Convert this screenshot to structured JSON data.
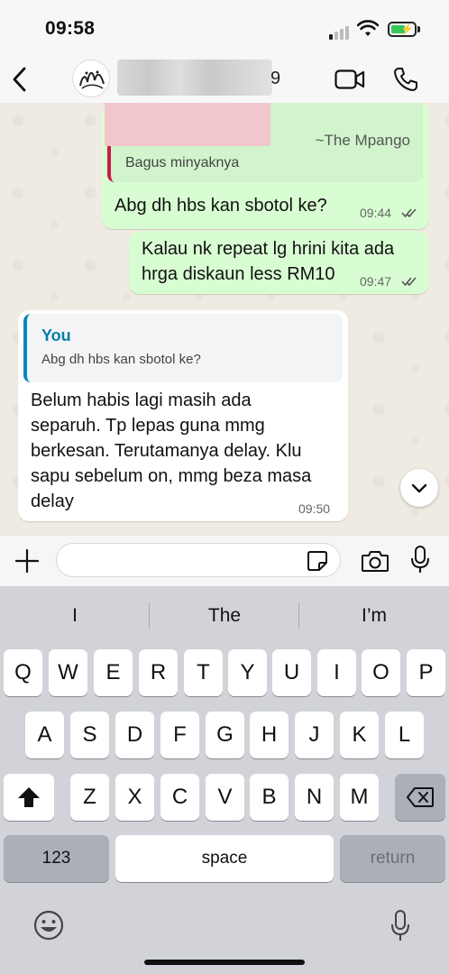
{
  "status_bar": {
    "time": "09:58"
  },
  "header": {
    "contact_name_suffix": "9"
  },
  "messages": {
    "quoted_out": {
      "sender": "~The Mpango",
      "text": "Bagus minyaknya"
    },
    "out1": {
      "text": "Abg dh hbs kan sbotol ke?",
      "time": "09:44"
    },
    "out2": {
      "line1": "Kalau nk repeat lg hrini kita ada",
      "line2": "hrga diskaun less RM10",
      "time": "09:47"
    },
    "in1": {
      "reply_author": "You",
      "reply_text": "Abg dh hbs kan sbotol ke?",
      "lines": [
        "Belum habis lagi masih ada",
        "separuh. Tp lepas guna mmg",
        "berkesan. Terutamanya delay. Klu",
        "sapu sebelum on, mmg beza masa",
        "delay"
      ],
      "time": "09:50"
    }
  },
  "composer": {
    "placeholder": ""
  },
  "keyboard": {
    "suggestions": [
      "I",
      "The",
      "I’m"
    ],
    "row1": [
      "Q",
      "W",
      "E",
      "R",
      "T",
      "Y",
      "U",
      "I",
      "O",
      "P"
    ],
    "row2": [
      "A",
      "S",
      "D",
      "F",
      "G",
      "H",
      "J",
      "K",
      "L"
    ],
    "row3": [
      "Z",
      "X",
      "C",
      "V",
      "B",
      "N",
      "M"
    ],
    "numbers_label": "123",
    "space_label": "space",
    "return_label": "return"
  },
  "colors": {
    "outgoing_bubble": "#d9fdd3",
    "incoming_bubble": "#ffffff",
    "reply_accent": "#0a87b8",
    "quote_accent": "#c71d46"
  }
}
